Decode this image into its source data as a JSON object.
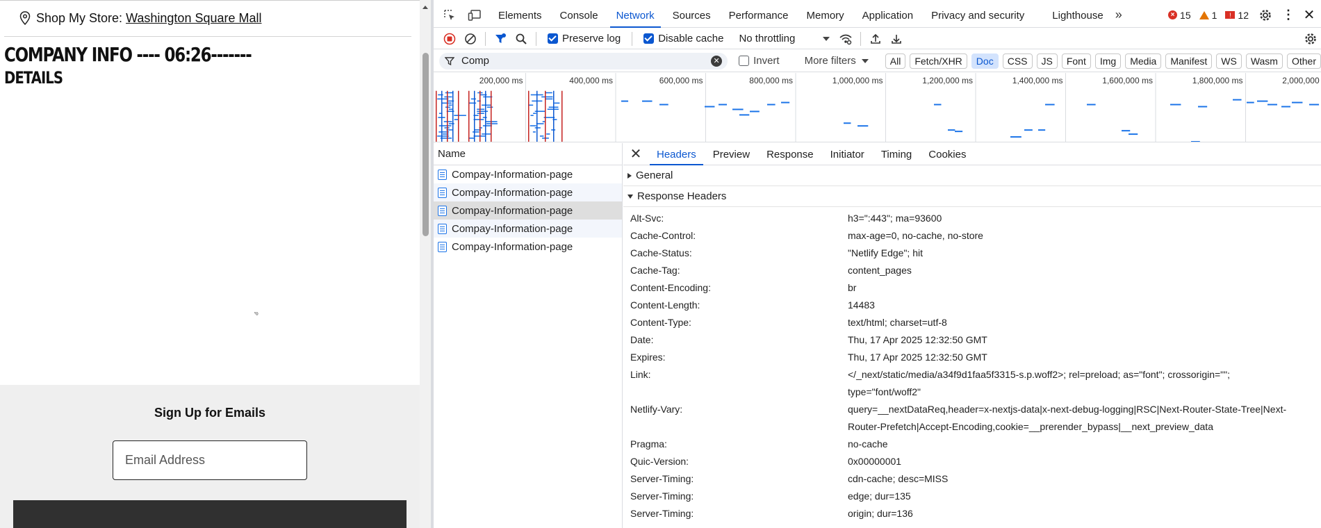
{
  "page": {
    "store_label": "Shop My Store:",
    "store_name": "Washington Square Mall",
    "title": "COMPANY INFO ---- 06:26-------",
    "subtitle": "DETAILS",
    "stray_mark": "'ᵒ",
    "signup_title": "Sign Up for Emails",
    "email_placeholder": "Email Address"
  },
  "devtools": {
    "tabs": [
      "Elements",
      "Console",
      "Network",
      "Sources",
      "Performance",
      "Memory",
      "Application",
      "Privacy and security",
      "Lighthouse"
    ],
    "active_tab": "Network",
    "errors": "15",
    "warnings": "1",
    "issues": "12",
    "toolbar": {
      "preserve_log": "Preserve log",
      "disable_cache": "Disable cache",
      "throttling": "No throttling"
    },
    "filter": {
      "value": "Comp",
      "invert": "Invert",
      "more_filters": "More filters",
      "chips": [
        "All",
        "Fetch/XHR",
        "Doc",
        "CSS",
        "JS",
        "Font",
        "Img",
        "Media",
        "Manifest",
        "WS",
        "Wasm",
        "Other"
      ],
      "active_chip": "Doc"
    },
    "timeline": {
      "ticks": [
        "200,000 ms",
        "400,000 ms",
        "600,000 ms",
        "800,000 ms",
        "1,000,000 ms",
        "1,200,000 ms",
        "1,400,000 ms",
        "1,600,000 ms",
        "1,800,000 ms",
        "2,000,000 ms"
      ],
      "colors": {
        "request": "#1a73e8",
        "marker_red": "#c5221f",
        "marker_blue": "#0b57d0"
      }
    },
    "requests": {
      "header": "Name",
      "items": [
        "Compay-Information-page",
        "Compay-Information-page",
        "Compay-Information-page",
        "Compay-Information-page",
        "Compay-Information-page"
      ],
      "selected_index": 2
    },
    "detail_tabs": [
      "Headers",
      "Preview",
      "Response",
      "Initiator",
      "Timing",
      "Cookies"
    ],
    "active_detail_tab": "Headers",
    "general_label": "General",
    "response_headers_label": "Response Headers",
    "response_headers": [
      {
        "k": "Alt-Svc:",
        "v": "h3=\":443\"; ma=93600"
      },
      {
        "k": "Cache-Control:",
        "v": "max-age=0, no-cache, no-store"
      },
      {
        "k": "Cache-Status:",
        "v": "\"Netlify Edge\"; hit"
      },
      {
        "k": "Cache-Tag:",
        "v": "content_pages"
      },
      {
        "k": "Content-Encoding:",
        "v": "br"
      },
      {
        "k": "Content-Length:",
        "v": "14483"
      },
      {
        "k": "Content-Type:",
        "v": "text/html; charset=utf-8"
      },
      {
        "k": "Date:",
        "v": "Thu, 17 Apr 2025 12:32:50 GMT"
      },
      {
        "k": "Expires:",
        "v": "Thu, 17 Apr 2025 12:32:50 GMT"
      },
      {
        "k": "Link:",
        "v": "</_next/static/media/a34f9d1faa5f3315-s.p.woff2>; rel=preload; as=\"font\"; crossorigin=\"\"; type=\"font/woff2\""
      },
      {
        "k": "Netlify-Vary:",
        "v": "query=__nextDataReq,header=x-nextjs-data|x-next-debug-logging|RSC|Next-Router-State-Tree|Next-Router-Prefetch|Accept-Encoding,cookie=__prerender_bypass|__next_preview_data"
      },
      {
        "k": "Pragma:",
        "v": "no-cache"
      },
      {
        "k": "Quic-Version:",
        "v": "0x00000001"
      },
      {
        "k": "Server-Timing:",
        "v": "cdn-cache; desc=MISS"
      },
      {
        "k": "Server-Timing:",
        "v": "edge; dur=135"
      },
      {
        "k": "Server-Timing:",
        "v": "origin; dur=136"
      }
    ]
  }
}
